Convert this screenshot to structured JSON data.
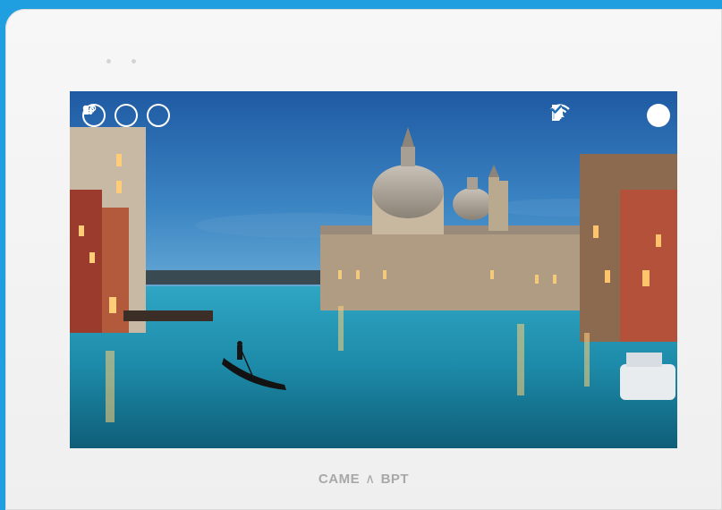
{
  "device": {
    "brand_left": "CAME",
    "brand_symbol": "∧",
    "brand_right": "BPT"
  },
  "left_icons": [
    {
      "name": "intercom-call-icon"
    },
    {
      "name": "voicemail-icon"
    },
    {
      "name": "door-lock-icon"
    }
  ],
  "right_icons": [
    {
      "name": "bell-icon"
    },
    {
      "name": "door-icon"
    },
    {
      "name": "wifi-icon"
    },
    {
      "name": "check-icon"
    }
  ],
  "colors": {
    "background": "#1f9fe0",
    "icon": "#ffffff",
    "check_mark": "#1f6fb0"
  }
}
